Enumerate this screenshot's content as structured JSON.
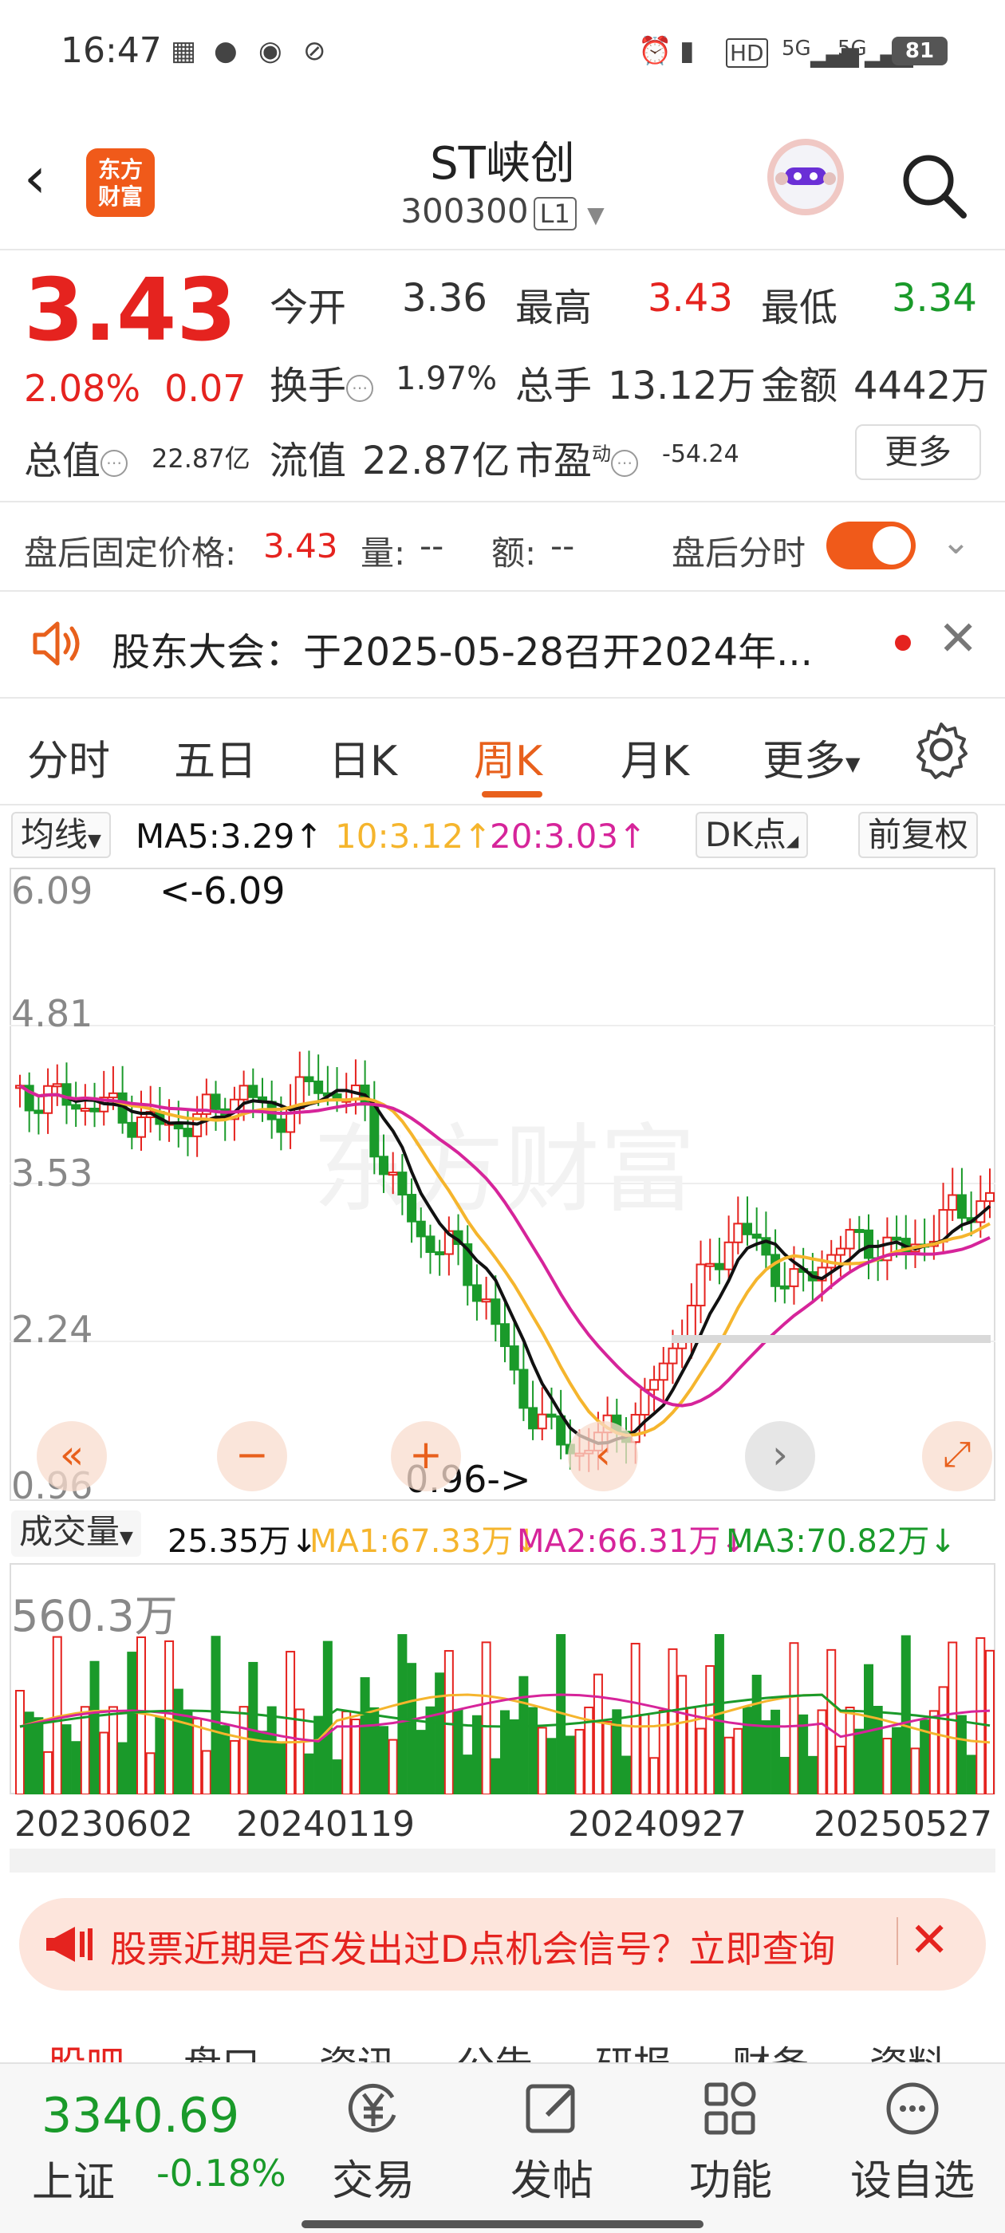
{
  "status_bar": {
    "time": "16:47",
    "network": "5G",
    "network2": "5G",
    "hd": "HD",
    "battery": "81"
  },
  "header": {
    "logo_line1": "东方",
    "logo_line2": "财富",
    "title": "ST峡创",
    "code": "300300",
    "level": "L1"
  },
  "quote": {
    "price": "3.43",
    "change_pct": "2.08%",
    "change": "0.07",
    "open_label": "今开",
    "open": "3.36",
    "high_label": "最高",
    "high": "3.43",
    "low_label": "最低",
    "low": "3.34",
    "turnover_label": "换手",
    "turnover": "1.97%",
    "volume_label": "总手",
    "volume": "13.12万",
    "amount_label": "金额",
    "amount": "4442万",
    "mktcap_label": "总值",
    "mktcap": "22.87亿",
    "float_label": "流值",
    "float": "22.87亿",
    "pe_label": "市盈",
    "pe_sup": "动",
    "pe": "-54.24",
    "more_button": "更多"
  },
  "after_hours": {
    "price_label": "盘后固定价格:",
    "price": "3.43",
    "vol_label": "量:",
    "vol": "--",
    "amt_label": "额:",
    "amt": "--",
    "toggle_label": "盘后分时",
    "toggle_on": true
  },
  "notice": {
    "text": "股东大会：于2025-05-28召开2024年..."
  },
  "tabs": [
    {
      "label": "分时",
      "active": false
    },
    {
      "label": "五日",
      "active": false
    },
    {
      "label": "日K",
      "active": false
    },
    {
      "label": "周K",
      "active": true
    },
    {
      "label": "月K",
      "active": false
    },
    {
      "label": "更多",
      "active": false
    }
  ],
  "ma_bar": {
    "selector": "均线",
    "ma5": "MA5:3.29↑",
    "ma10": "10:3.12↑",
    "ma20": "20:3.03↑",
    "dk": "DK点",
    "adjust": "前复权"
  },
  "kchart": {
    "y_labels": [
      "6.09",
      "4.81",
      "3.53",
      "2.24",
      "0.96"
    ],
    "max_note": "<-6.09",
    "min_note": "0.96->",
    "watermark": "东方财富"
  },
  "volume_bar": {
    "selector": "成交量",
    "vol": "25.35万↓",
    "ma1": "MA1:67.33万↓",
    "ma2": "MA2:66.31万↓",
    "ma3": "MA3:70.82万↓",
    "max_label": "560.3万"
  },
  "dates": [
    "20230602",
    "20240119",
    "20240927",
    "20250527"
  ],
  "colors": {
    "up": "#e5231f",
    "down": "#1a9a2a",
    "accent": "#e8601c",
    "ma5": "#111111",
    "ma10": "#f5b52d",
    "ma20": "#d6249a"
  },
  "promo": {
    "text": "股票近期是否发出过D点机会信号？立即查询"
  },
  "subtabs": [
    "股吧",
    "盘口",
    "资讯",
    "公告",
    "研报",
    "财务",
    "资料"
  ],
  "bottom_nav": {
    "index_value": "3340.69",
    "index_name": "上证",
    "index_change": "-0.18%",
    "items": [
      "交易",
      "发帖",
      "功能",
      "设自选"
    ]
  }
}
